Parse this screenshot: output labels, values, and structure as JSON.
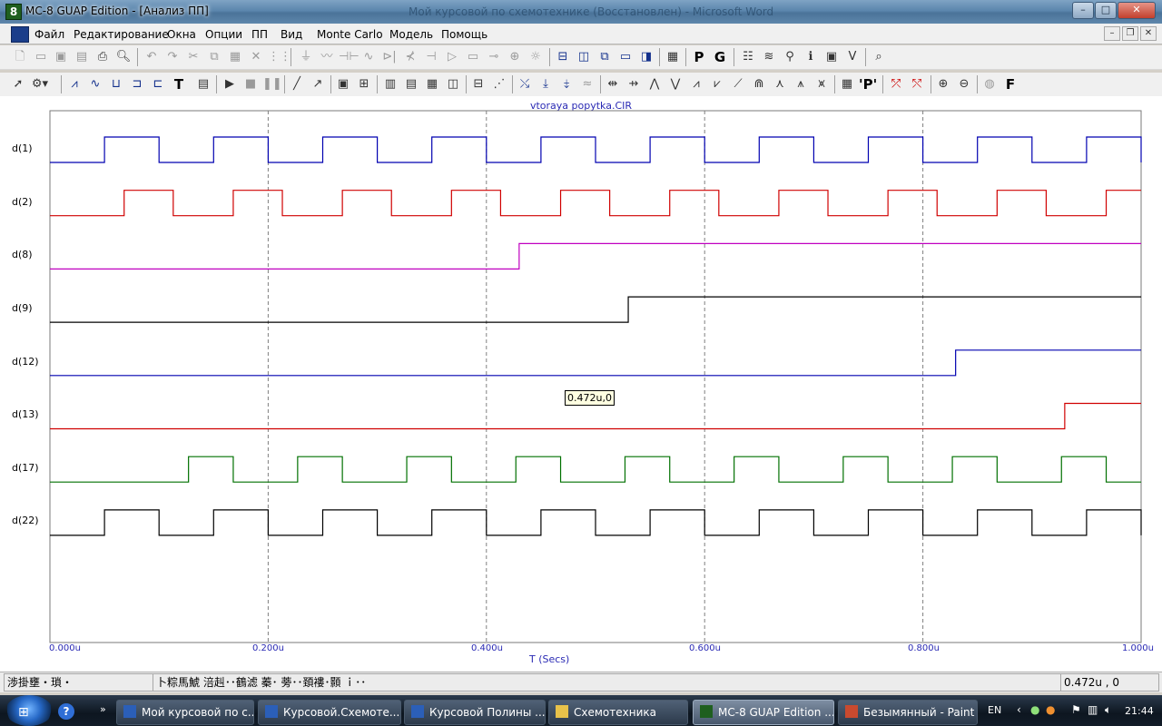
{
  "window": {
    "title": "MC-8 GUAP Edition - [Анализ ПП]",
    "background_title": "Мой курсовой по схемотехнике (Восстановлен) - Microsoft Word",
    "controls": [
      "–",
      "□",
      "✕"
    ],
    "mdi_controls": [
      "–",
      "❐",
      "✕"
    ]
  },
  "menu": [
    "Файл",
    "Редактирование",
    "Окна",
    "Опции",
    "ПП",
    "Вид",
    "Monte Carlo",
    "Модель",
    "Помощь"
  ],
  "plot": {
    "file_title": "vtoraya popytka.CIR",
    "signals": [
      {
        "label": "d(1)",
        "color": "#0000b0"
      },
      {
        "label": "d(2)",
        "color": "#d00000"
      },
      {
        "label": "d(8)",
        "color": "#c000c0"
      },
      {
        "label": "d(9)",
        "color": "#000000"
      },
      {
        "label": "d(12)",
        "color": "#0000b0"
      },
      {
        "label": "d(13)",
        "color": "#d00000"
      },
      {
        "label": "d(17)",
        "color": "#007000"
      },
      {
        "label": "d(22)",
        "color": "#000000"
      }
    ],
    "x_ticks": [
      "0.000u",
      "0.200u",
      "0.400u",
      "0.600u",
      "0.800u",
      "1.000u"
    ],
    "x_title": "T (Secs)",
    "tooltip": "0.472u,0"
  },
  "chart_data": {
    "type": "line",
    "title": "vtoraya popytka.CIR",
    "xlabel": "T (Secs)",
    "xlim": [
      0,
      1.0
    ],
    "x_unit": "u",
    "grid": true,
    "series": [
      {
        "name": "d(1)",
        "initial": 0,
        "transitions_us": [
          0.05,
          0.1,
          0.15,
          0.2,
          0.25,
          0.3,
          0.35,
          0.4,
          0.45,
          0.5,
          0.55,
          0.6,
          0.65,
          0.7,
          0.75,
          0.8,
          0.85,
          0.9,
          0.95,
          1.0
        ]
      },
      {
        "name": "d(2)",
        "initial": 0,
        "transitions_us": [
          0.068,
          0.113,
          0.168,
          0.213,
          0.268,
          0.313,
          0.368,
          0.413,
          0.468,
          0.513,
          0.568,
          0.613,
          0.668,
          0.713,
          0.768,
          0.813,
          0.868,
          0.913,
          0.968
        ]
      },
      {
        "name": "d(8)",
        "initial": 0,
        "transitions_us": [
          0.43
        ]
      },
      {
        "name": "d(9)",
        "initial": 0,
        "transitions_us": [
          0.53
        ]
      },
      {
        "name": "d(12)",
        "initial": 0,
        "transitions_us": [
          0.83
        ]
      },
      {
        "name": "d(13)",
        "initial": 0,
        "transitions_us": [
          0.93
        ]
      },
      {
        "name": "d(17)",
        "initial": 0,
        "transitions_us": [
          0.127,
          0.168,
          0.227,
          0.268,
          0.327,
          0.368,
          0.427,
          0.468,
          0.527,
          0.568,
          0.627,
          0.668,
          0.727,
          0.768,
          0.827,
          0.868,
          0.927,
          0.968
        ]
      },
      {
        "name": "d(22)",
        "initial": 0,
        "transitions_us": [
          0.05,
          0.1,
          0.15,
          0.2,
          0.25,
          0.3,
          0.35,
          0.4,
          0.45,
          0.5,
          0.55,
          0.6,
          0.65,
          0.7,
          0.75,
          0.8,
          0.85,
          0.9,
          0.95,
          1.0
        ]
      }
    ]
  },
  "status": {
    "left": "渉掛壅・瑣・",
    "middle": "卜粽馬鯱 涪赳･･鶴滤 蓁･ 蒡･･頚褸･顥 ｉ･･",
    "right": "0.472u , 0"
  },
  "taskbar": {
    "tasks": [
      {
        "label": "Мой курсовой по с...",
        "icon_color": "#2b5fb8"
      },
      {
        "label": "Курсовой.Схемоте...",
        "icon_color": "#2b5fb8"
      },
      {
        "label": "Курсовой Полины ...",
        "icon_color": "#2b5fb8"
      },
      {
        "label": "Схемотехника",
        "icon_color": "#e8c24a"
      },
      {
        "label": "MC-8 GUAP Edition ...",
        "icon_color": "#1f5f1f"
      },
      {
        "label": "Безымянный - Paint",
        "icon_color": "#c94a2f"
      }
    ],
    "language": "EN",
    "clock": "21:44"
  }
}
